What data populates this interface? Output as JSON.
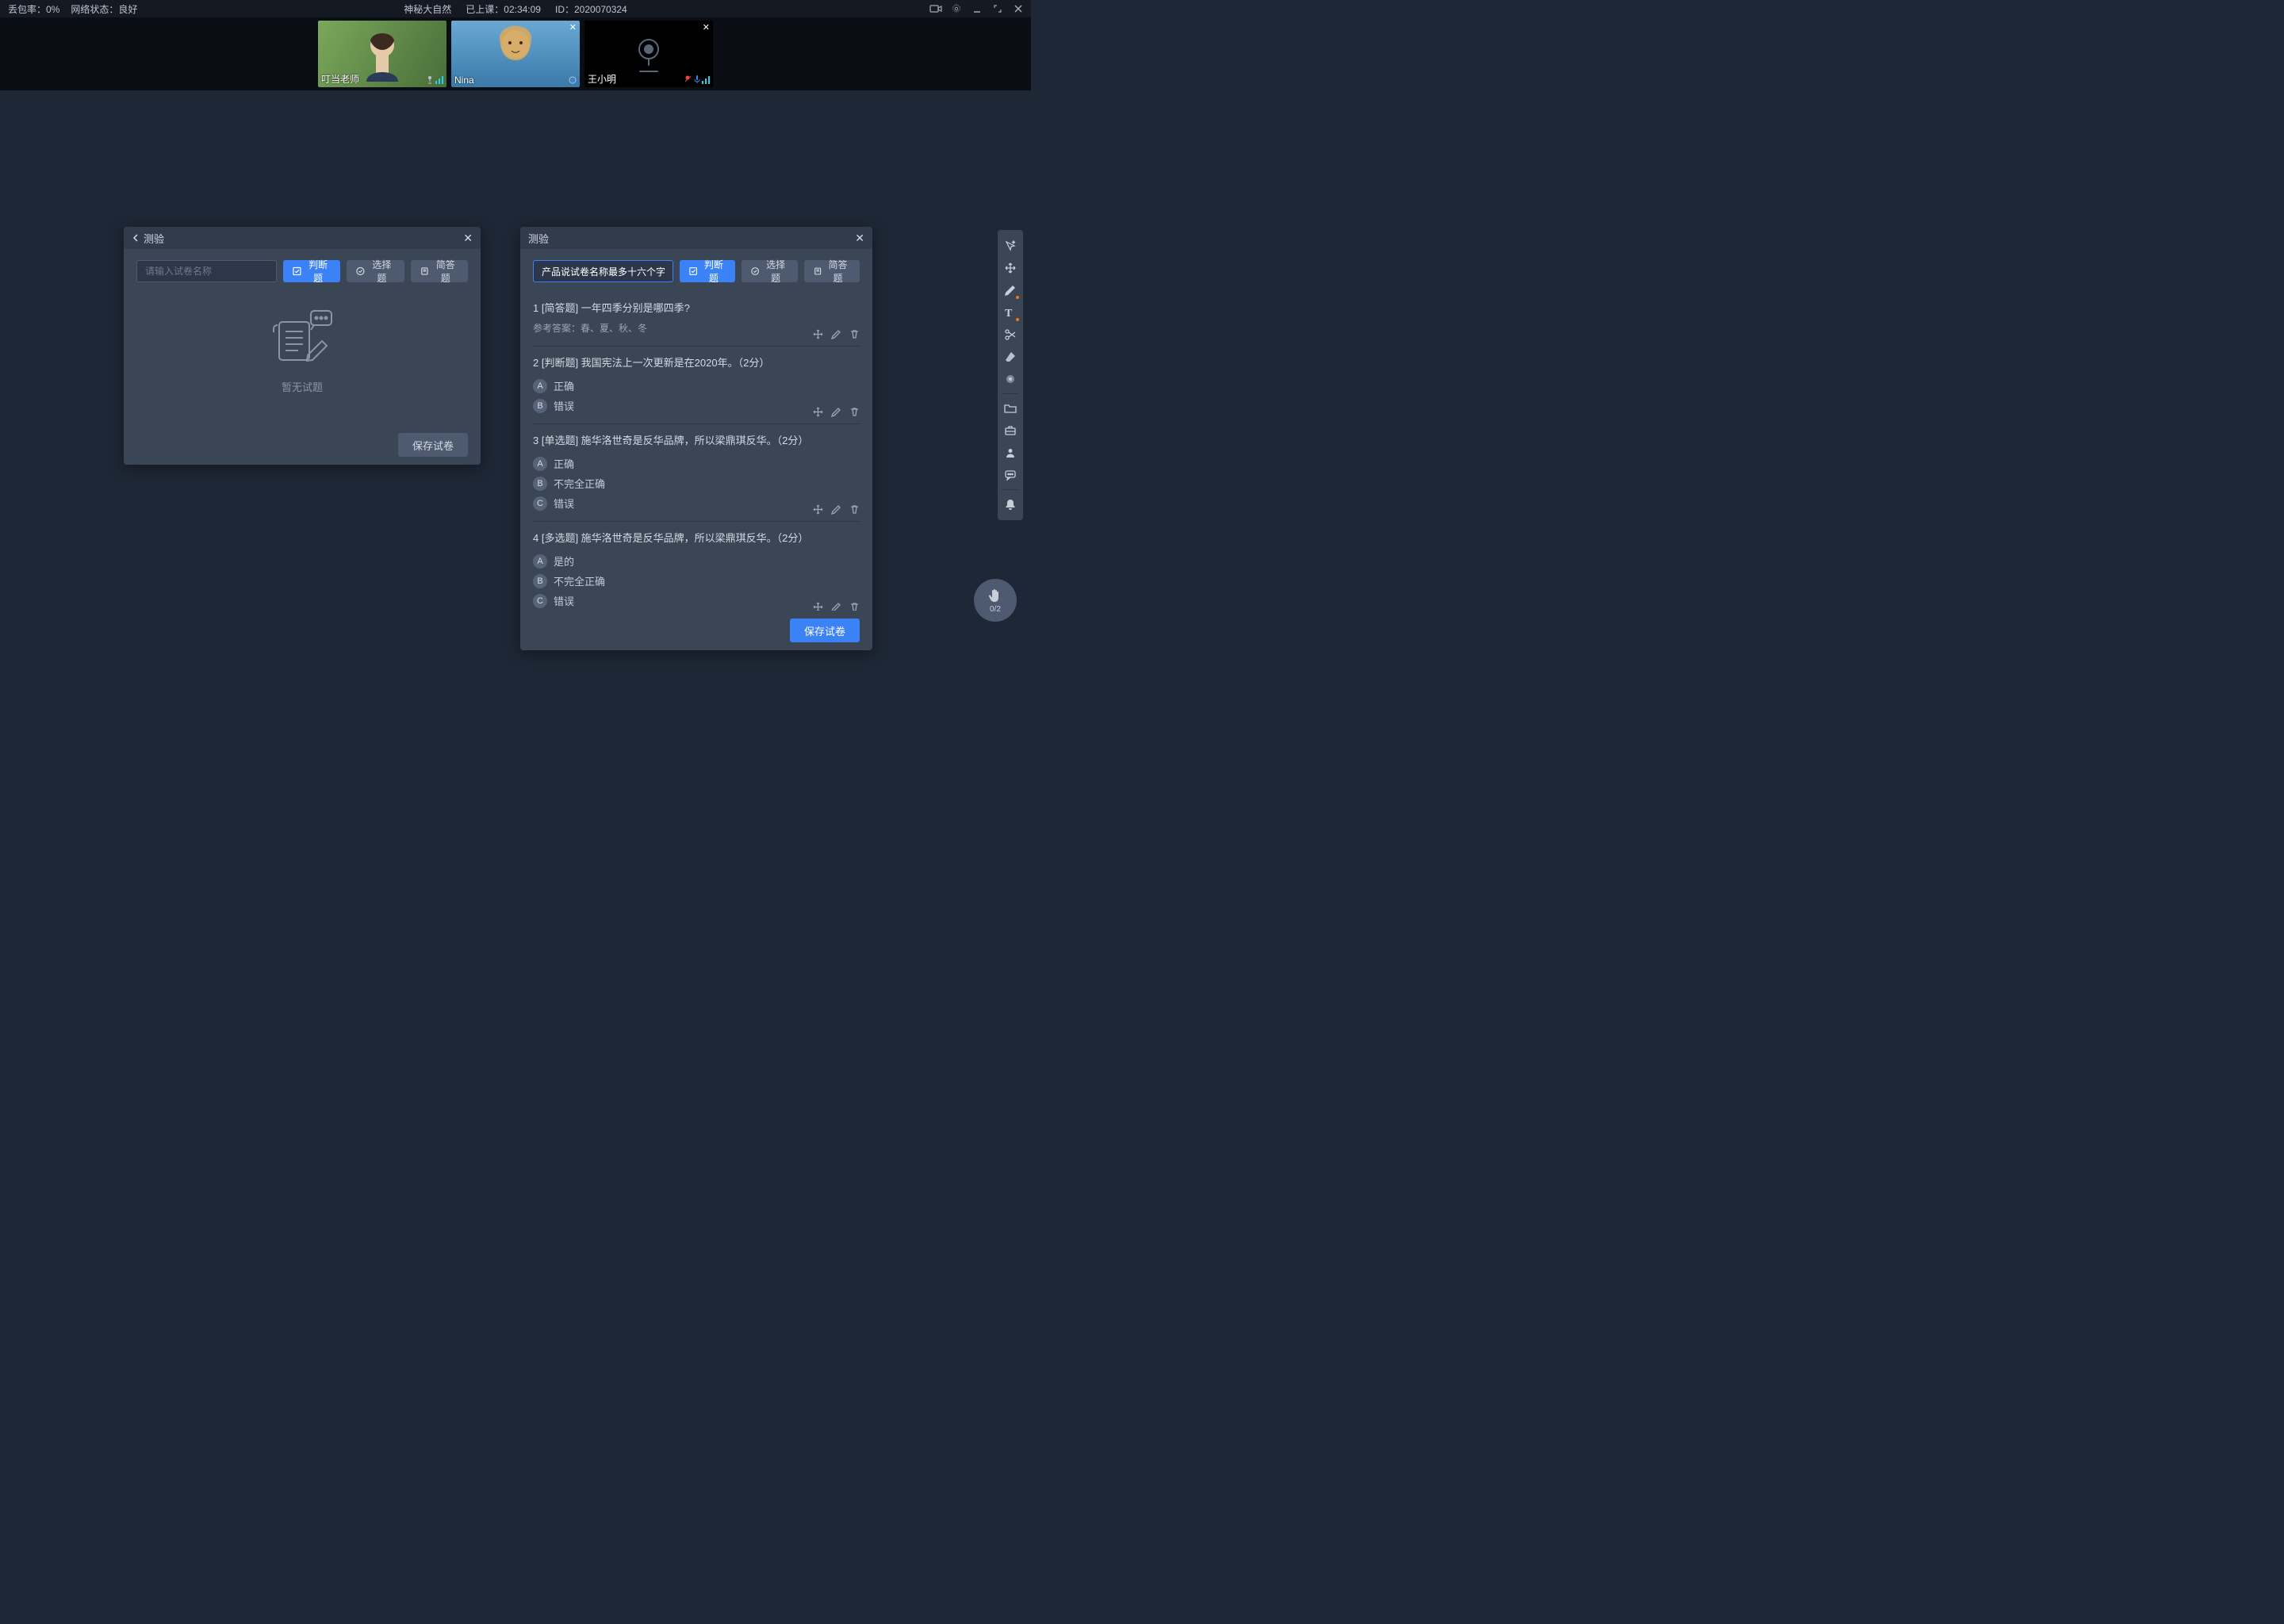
{
  "topbar": {
    "packet_loss_label": "丢包率：0%",
    "network_label": "网络状态：良好",
    "course_name": "神秘大自然",
    "elapsed_label": "已上课：02:34:09",
    "session_id": "ID：2020070324"
  },
  "participants": [
    {
      "name": "叮当老师",
      "camera_off": false,
      "closeable": false,
      "muted": false
    },
    {
      "name": "Nina",
      "camera_off": false,
      "closeable": true,
      "muted": false
    },
    {
      "name": "王小明",
      "camera_off": true,
      "closeable": true,
      "muted": true
    }
  ],
  "panel_left": {
    "title": "测验",
    "search_placeholder": "请输入试卷名称",
    "btn_judge": "判断题",
    "btn_choice": "选择题",
    "btn_short": "简答题",
    "empty_text": "暂无试题",
    "save_label": "保存试卷"
  },
  "panel_right": {
    "title": "测验",
    "exam_name": "产品说试卷名称最多十六个字",
    "btn_judge": "判断题",
    "btn_choice": "选择题",
    "btn_short": "简答题",
    "save_label": "保存试卷",
    "questions": [
      {
        "index": 1,
        "type_label": "[简答题]",
        "text": "一年四季分别是哪四季?",
        "answer_ref": "参考答案：春、夏、秋、冬",
        "options": []
      },
      {
        "index": 2,
        "type_label": "[判断题]",
        "text": "我国宪法上一次更新是在2020年。（2分）",
        "options": [
          {
            "letter": "A",
            "label": "正确"
          },
          {
            "letter": "B",
            "label": "错误"
          }
        ]
      },
      {
        "index": 3,
        "type_label": "[单选题]",
        "text": "施华洛世奇是反华品牌，所以梁鼎琪反华。（2分）",
        "options": [
          {
            "letter": "A",
            "label": "正确"
          },
          {
            "letter": "B",
            "label": "不完全正确"
          },
          {
            "letter": "C",
            "label": "错误"
          }
        ]
      },
      {
        "index": 4,
        "type_label": "[多选题]",
        "text": "施华洛世奇是反华品牌，所以梁鼎琪反华。（2分）",
        "options": [
          {
            "letter": "A",
            "label": "是的"
          },
          {
            "letter": "B",
            "label": "不完全正确"
          },
          {
            "letter": "C",
            "label": "错误"
          }
        ]
      }
    ]
  },
  "side_tools": [
    "cursor-sparkle-icon",
    "move-icon",
    "pen-icon",
    "text-icon",
    "scissors-icon",
    "eraser-icon",
    "color-picker-icon",
    "sep",
    "folder-icon",
    "toolbox-icon",
    "user-icon",
    "chat-icon",
    "sep",
    "bell-icon"
  ],
  "hand_fab": {
    "count": "0/2"
  }
}
